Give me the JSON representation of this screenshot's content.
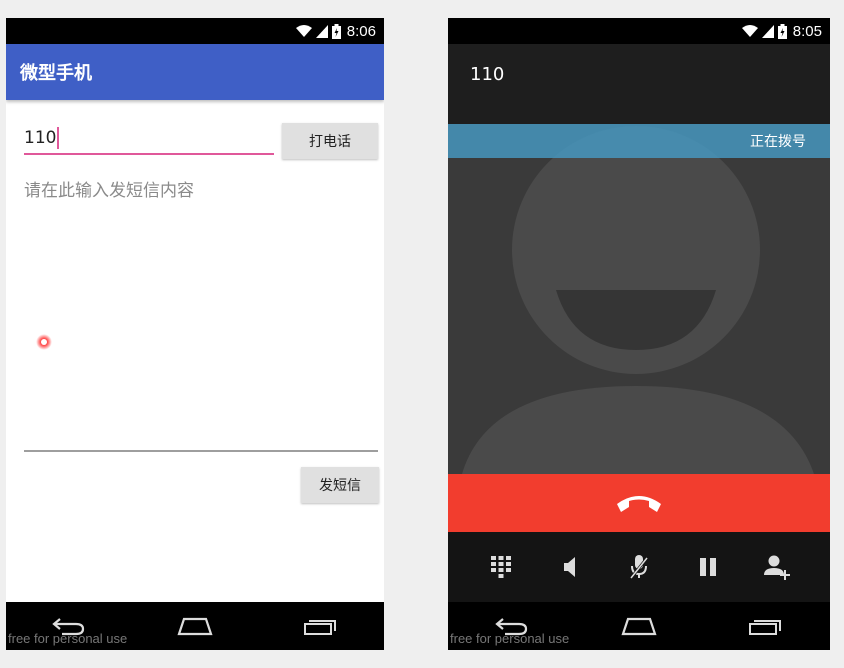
{
  "left_phone": {
    "status_time": "8:06",
    "app_title": "微型手机",
    "phone_input_value": "110",
    "call_button_label": "打电话",
    "sms_placeholder": "请在此输入发短信内容",
    "sms_button_label": "发短信",
    "watermark": "free for personal use"
  },
  "right_phone": {
    "status_time": "8:05",
    "dialed_number": "110",
    "call_status": "正在拨号",
    "watermark": "free for personal use"
  },
  "colors": {
    "app_bar": "#3f5fc6",
    "accent": "#e0589a",
    "end_call": "#f23d2e",
    "status_banner": "#4696be"
  },
  "icons": [
    "wifi-icon",
    "cell-signal-icon",
    "battery-icon",
    "back-icon",
    "home-icon",
    "recents-icon",
    "end-call-icon",
    "dialpad-icon",
    "speaker-icon",
    "mute-icon",
    "hold-icon",
    "add-call-icon"
  ]
}
